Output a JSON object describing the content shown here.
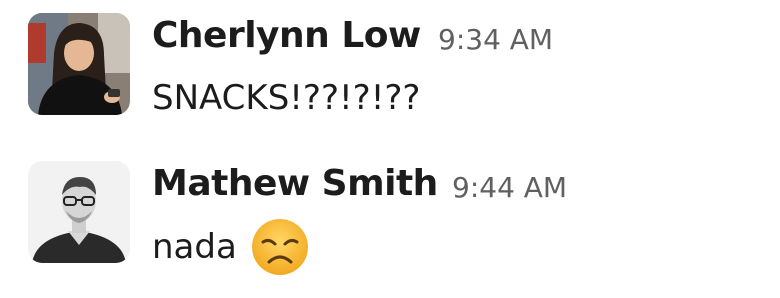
{
  "messages": [
    {
      "sender": "Cherlynn Low",
      "time": "9:34 AM",
      "text": "SNACKS!??!?!??",
      "avatar_icon": "user-photo-avatar"
    },
    {
      "sender": "Mathew Smith",
      "time": "9:44 AM",
      "text": "nada",
      "emoji": "disappointed-face-icon",
      "avatar_icon": "user-photo-avatar"
    }
  ],
  "colors": {
    "name": "#1d1c1d",
    "timestamp": "#616061",
    "emoji_face": "#f7b92f"
  }
}
